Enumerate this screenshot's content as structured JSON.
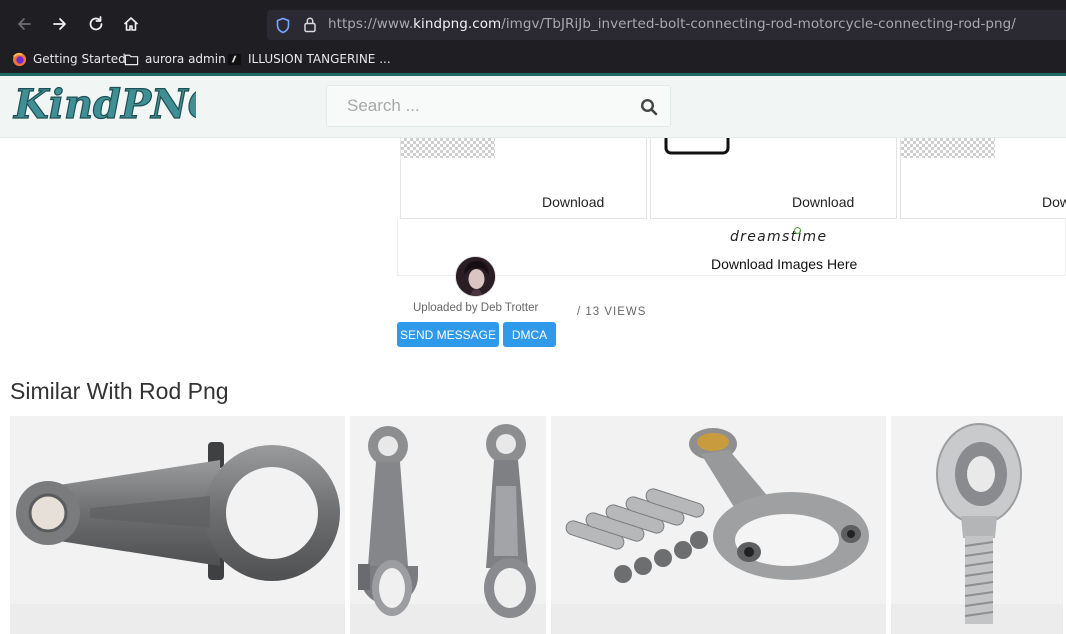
{
  "browser": {
    "url_prefix": "https://www.",
    "url_domain": "kindpng.com",
    "url_path": "/imgv/TbJRiJb_inverted-bolt-connecting-rod-motorcycle-connecting-rod-png/",
    "bookmarks": [
      {
        "label": "Getting Started",
        "icon": "firefox-icon"
      },
      {
        "label": "aurora admin",
        "icon": "folder-icon"
      },
      {
        "label": "ILLUSION TANGERINE ...",
        "icon": "bookmark-favicon"
      }
    ]
  },
  "site": {
    "logo_text": "KindPNG",
    "search_placeholder": "Search ..."
  },
  "cards": [
    {
      "download_label": "Download"
    },
    {
      "download_label": "Download"
    },
    {
      "download_label": "Dow"
    }
  ],
  "ad": {
    "brand": "dreamstime",
    "tagline": "Download Images Here"
  },
  "uploader": {
    "text": "Uploaded by Deb Trotter",
    "views": "/ 13 VIEWS",
    "send_message_label": "SEND MESSAGE",
    "dmca_label": "DMCA"
  },
  "similar": {
    "title": "Similar With Rod Png",
    "tiles": [
      {
        "subject": "connecting-rod"
      },
      {
        "subject": "two-connecting-rods"
      },
      {
        "subject": "connecting-rod-with-bolts"
      },
      {
        "subject": "rod-end-bearing"
      }
    ]
  },
  "colors": {
    "chrome_bg": "#1f1e22",
    "accent": "#1d6a64",
    "button_blue": "#2f9ae9",
    "logo_teal": "#3f8f95"
  }
}
